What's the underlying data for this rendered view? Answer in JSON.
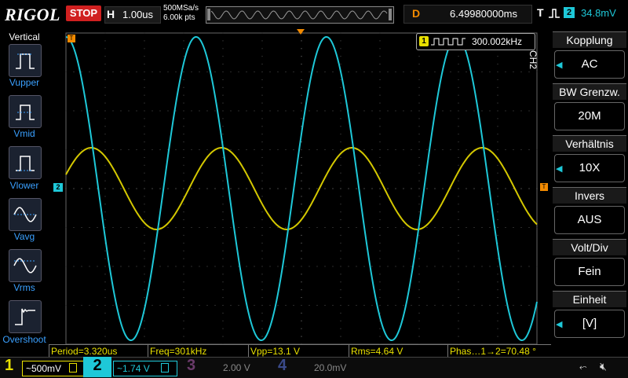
{
  "header": {
    "brand": "RIGOL",
    "run_state": "STOP",
    "horizontal": {
      "label": "H",
      "scale": "1.00us"
    },
    "sample_rate": "500MSa/s",
    "memory_depth": "6.00k pts",
    "delay": {
      "label": "D",
      "value": "6.49980000ms"
    },
    "trigger": {
      "label": "T",
      "source": "2",
      "level": "34.8mV"
    }
  },
  "left_menu": {
    "title": "Vertical",
    "items": [
      {
        "label": "Vupper",
        "icon": "vupper-icon"
      },
      {
        "label": "Vmid",
        "icon": "vmid-icon"
      },
      {
        "label": "Vlower",
        "icon": "vlower-icon"
      },
      {
        "label": "Vavg",
        "icon": "vavg-icon"
      },
      {
        "label": "Vrms",
        "icon": "vrms-icon"
      },
      {
        "label": "Overshoot",
        "icon": "overshoot-icon"
      }
    ]
  },
  "right_menu": {
    "channel_tag": "CH2",
    "items": [
      {
        "title": "Kopplung",
        "value": "AC",
        "has_arrow": true
      },
      {
        "title": "BW Grenzw.",
        "value": "20M",
        "has_arrow": false
      },
      {
        "title": "Verhältnis",
        "value": "10X",
        "has_arrow": true
      },
      {
        "title": "Invers",
        "value": "AUS",
        "has_arrow": false
      },
      {
        "title": "Volt/Div",
        "value": "Fein",
        "has_arrow": false
      },
      {
        "title": "Einheit",
        "value": "[V]",
        "has_arrow": true
      }
    ]
  },
  "frequency_counter": {
    "channel": "1",
    "value": "300.002kHz"
  },
  "markers": {
    "ch1": "1",
    "ch2": "2",
    "trigger_level": "T",
    "trigger_pos": "T"
  },
  "measurements": [
    {
      "text": "Period=3.320us"
    },
    {
      "text": "Freq=301kHz"
    },
    {
      "text": "Vpp=13.1 V"
    },
    {
      "text": "Rms=4.64 V"
    },
    {
      "text": "Phas…1→2=70.48 °"
    }
  ],
  "channels": [
    {
      "num": "1",
      "scale": "~500mV",
      "color": "#e8e000",
      "active": true
    },
    {
      "num": "2",
      "scale": "~1.74 V",
      "color": "#1ec8d8",
      "active": true
    },
    {
      "num": "3",
      "scale": "2.00 V",
      "color": "#c040c0",
      "active": false
    },
    {
      "num": "4",
      "scale": "20.0mV",
      "color": "#4060e0",
      "active": false
    }
  ],
  "waveforms": {
    "ch1": {
      "color": "#d4c800",
      "period_divs": 3.32,
      "amplitude_divs": 1.05,
      "phase_deg": 0
    },
    "ch2": {
      "color": "#1ec8d8",
      "period_divs": 3.32,
      "amplitude_divs": 3.9,
      "phase_deg": 70.48
    }
  },
  "colors": {
    "accent": "#f28a00",
    "ch1": "#e8e000",
    "ch2": "#1ec8d8",
    "stop": "#d02020"
  }
}
